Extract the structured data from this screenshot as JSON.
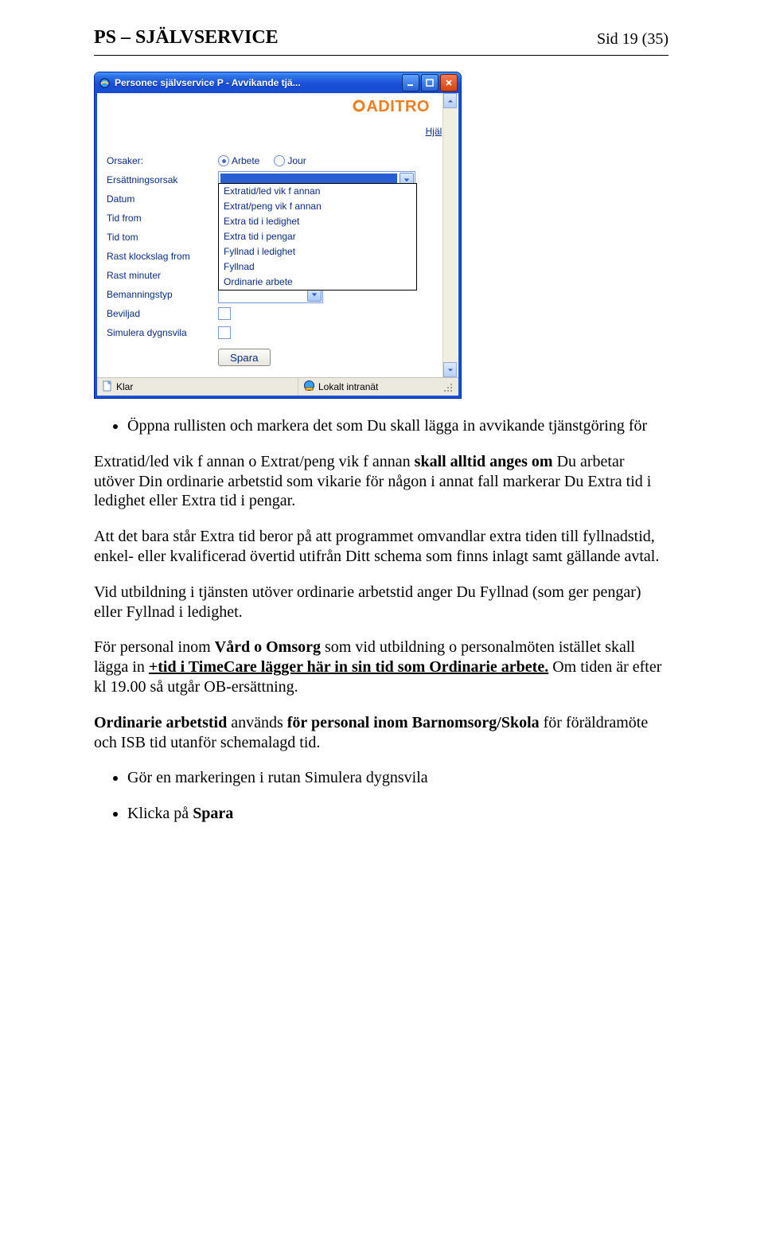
{
  "header": {
    "title": "PS – SJÄLVSERVICE",
    "page_marker": "Sid 19 (35)"
  },
  "window": {
    "titlebar": "Personec självservice P - Avvikande tjä...",
    "brand": "ADITRO",
    "help_link": "Hjälp",
    "statusbar": {
      "ready": "Klar",
      "zone": "Lokalt intranät"
    },
    "form": {
      "orsaker_label": "Orsaker:",
      "radio_arbete": "Arbete",
      "radio_jour": "Jour",
      "labels": {
        "ersattningsorsak": "Ersättningsorsak",
        "datum": "Datum",
        "tid_from": "Tid from",
        "tid_tom": "Tid tom",
        "rast_klockslag_from": "Rast klockslag from",
        "rast_minuter": "Rast minuter",
        "bemanningstyp": "Bemanningstyp",
        "beviljad": "Beviljad",
        "simulera": "Simulera dygnsvila"
      },
      "dropdown_options": [
        "Extratid/led vik f annan",
        "Extrat/peng vik f annan",
        "Extra tid i ledighet",
        "Extra tid i pengar",
        "Fyllnad i ledighet",
        "Fyllnad",
        "Ordinarie arbete"
      ],
      "save_button": "Spara"
    }
  },
  "body": {
    "bullet1": "Öppna rullisten och markera det som Du skall lägga in avvikande tjänstgöring för",
    "p1_pre": "Extratid/led vik f annan o Extrat/peng vik f annan ",
    "p1_b1": "skall alltid anges om",
    "p1_mid": " Du arbetar utöver Din ordinarie arbetstid som vikarie för någon i annat fall markerar Du Extra tid i ledighet eller Extra tid i pengar.",
    "p2": "Att det bara står Extra tid beror på att programmet omvandlar extra tiden till fyllnadstid, enkel- eller kvalificerad övertid utifrån Ditt schema som finns inlagt samt gällande avtal.",
    "p3": "Vid utbildning i tjänsten utöver ordinarie arbetstid anger Du Fyllnad (som ger pengar) eller Fyllnad i ledighet.",
    "p4_pre": "För personal inom ",
    "p4_b1": "Vård o Omsorg",
    "p4_mid1": " som vid utbildning o personalmöten istället skall lägga in ",
    "p4_u1": "+tid i TimeCare lägger här in sin tid som Ordinarie arbete.",
    "p4_mid2": " Om tiden är efter kl 19.00 så utgår OB-ersättning.",
    "p5_b1": "Ordinarie arbetstid",
    "p5_mid": " används ",
    "p5_b2": "för personal inom Barnomsorg/Skola",
    "p5_tail": " för föräldramöte och ISB tid utanför schemalagd tid.",
    "bullet2": "Gör en markeringen i rutan Simulera dygnsvila",
    "bullet3_pre": "Klicka på ",
    "bullet3_b": "Spara"
  }
}
